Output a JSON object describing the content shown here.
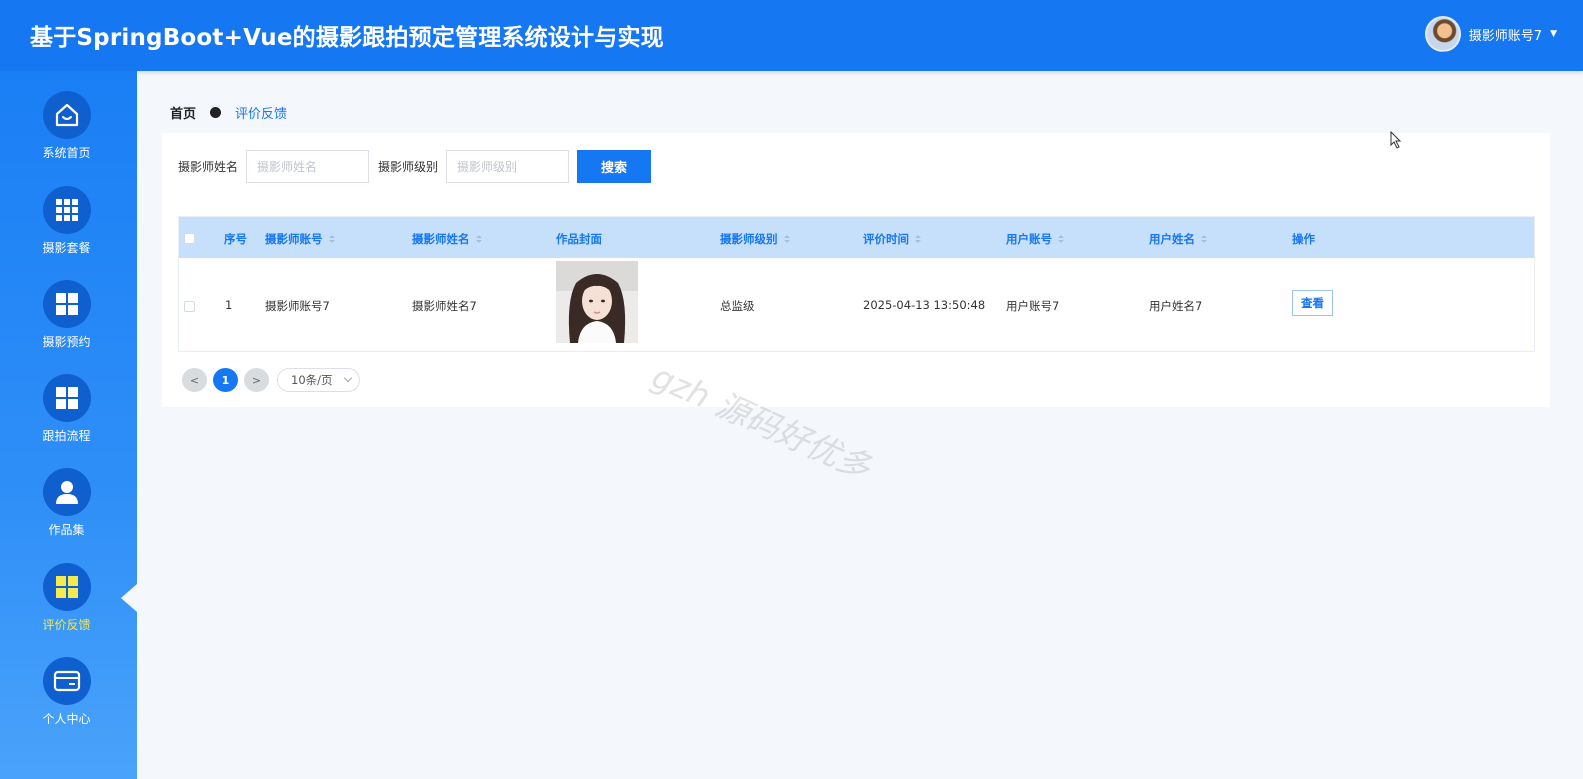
{
  "header": {
    "title": "基于SpringBoot+Vue的摄影跟拍预定管理系统设计与实现",
    "username": "摄影师账号7",
    "avatar_icon": "user-avatar",
    "caret": "▼"
  },
  "sidebar": {
    "items": [
      {
        "label": "系统首页",
        "icon": "home-icon",
        "active": false
      },
      {
        "label": "摄影套餐",
        "icon": "grid-nine-icon",
        "active": false
      },
      {
        "label": "摄影预约",
        "icon": "grid-four-icon",
        "active": false
      },
      {
        "label": "跟拍流程",
        "icon": "grid-four-icon",
        "active": false
      },
      {
        "label": "作品集",
        "icon": "user-icon",
        "active": false
      },
      {
        "label": "评价反馈",
        "icon": "grid-four-icon",
        "active": true
      },
      {
        "label": "个人中心",
        "icon": "wallet-icon",
        "active": false
      }
    ],
    "active_color": "#f5ea4e"
  },
  "breadcrumb": {
    "home": "首页",
    "current": "评价反馈"
  },
  "search": {
    "name_label": "摄影师姓名",
    "name_placeholder": "摄影师姓名",
    "level_label": "摄影师级别",
    "level_placeholder": "摄影师级别",
    "button": "搜索"
  },
  "table": {
    "headers": {
      "index": "序号",
      "account": "摄影师账号",
      "name": "摄影师姓名",
      "cover": "作品封面",
      "level": "摄影师级别",
      "time": "评价时间",
      "user_account": "用户账号",
      "user_name": "用户姓名",
      "action": "操作"
    },
    "rows": [
      {
        "index": "1",
        "account": "摄影师账号7",
        "name": "摄影师姓名7",
        "level": "总监级",
        "time": "2025-04-13 13:50:48",
        "user_account": "用户账号7",
        "user_name": "用户姓名7",
        "action": "查看"
      }
    ]
  },
  "pagination": {
    "prev": "<",
    "current_page": "1",
    "next": ">",
    "page_size": "10条/页"
  },
  "watermark": "gzh 源码好优多",
  "colors": {
    "primary": "#1677f2",
    "header_bg": "#1677f2",
    "table_header_bg": "#c6e0fc",
    "page_bg": "#f4f8fd"
  }
}
